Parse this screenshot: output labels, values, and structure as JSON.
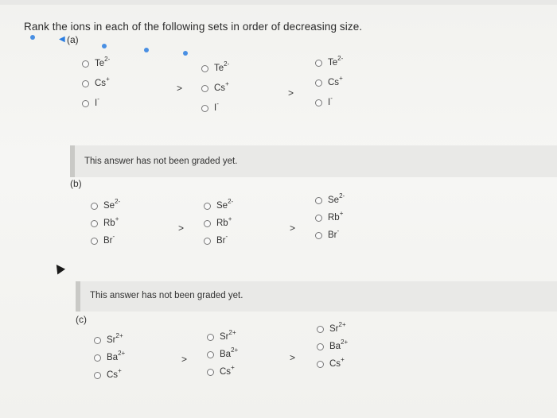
{
  "question": "Rank the ions in each of the following sets in order of decreasing size.",
  "part_a": {
    "label": "(a)",
    "col1": [
      {
        "base": "Te",
        "sup": "2-"
      },
      {
        "base": "Cs",
        "sup": "+"
      },
      {
        "base": "I",
        "sup": "-"
      }
    ],
    "col2": [
      {
        "base": "Te",
        "sup": "2-"
      },
      {
        "base": "Cs",
        "sup": "+"
      },
      {
        "base": "I",
        "sup": "-"
      }
    ],
    "col3": [
      {
        "base": "Te",
        "sup": "2-"
      },
      {
        "base": "Cs",
        "sup": "+"
      },
      {
        "base": "I",
        "sup": "-"
      }
    ],
    "separator": ">"
  },
  "graded_msg_1": "This answer has not been graded yet.",
  "part_b": {
    "label": "(b)",
    "col1": [
      {
        "base": "Se",
        "sup": "2-"
      },
      {
        "base": "Rb",
        "sup": "+"
      },
      {
        "base": "Br",
        "sup": "-"
      }
    ],
    "col2": [
      {
        "base": "Se",
        "sup": "2-"
      },
      {
        "base": "Rb",
        "sup": "+"
      },
      {
        "base": "Br",
        "sup": "-"
      }
    ],
    "col3": [
      {
        "base": "Se",
        "sup": "2-"
      },
      {
        "base": "Rb",
        "sup": "+"
      },
      {
        "base": "Br",
        "sup": "-"
      }
    ],
    "separator": ">"
  },
  "graded_msg_2": "This answer has not been graded yet.",
  "part_c": {
    "label": "(c)",
    "col1": [
      {
        "base": "Sr",
        "sup": "2+"
      },
      {
        "base": "Ba",
        "sup": "2+"
      },
      {
        "base": "Cs",
        "sup": "+"
      }
    ],
    "col2": [
      {
        "base": "Sr",
        "sup": "2+"
      },
      {
        "base": "Ba",
        "sup": "2+"
      },
      {
        "base": "Cs",
        "sup": "+"
      }
    ],
    "col3": [
      {
        "base": "Sr",
        "sup": "2+"
      },
      {
        "base": "Ba",
        "sup": "2+"
      },
      {
        "base": "Cs",
        "sup": "+"
      }
    ],
    "separator": ">"
  },
  "colors": {
    "accent": "#2a7de1",
    "panel": "#e9e9e7",
    "panel_border": "#c9c9c6"
  }
}
